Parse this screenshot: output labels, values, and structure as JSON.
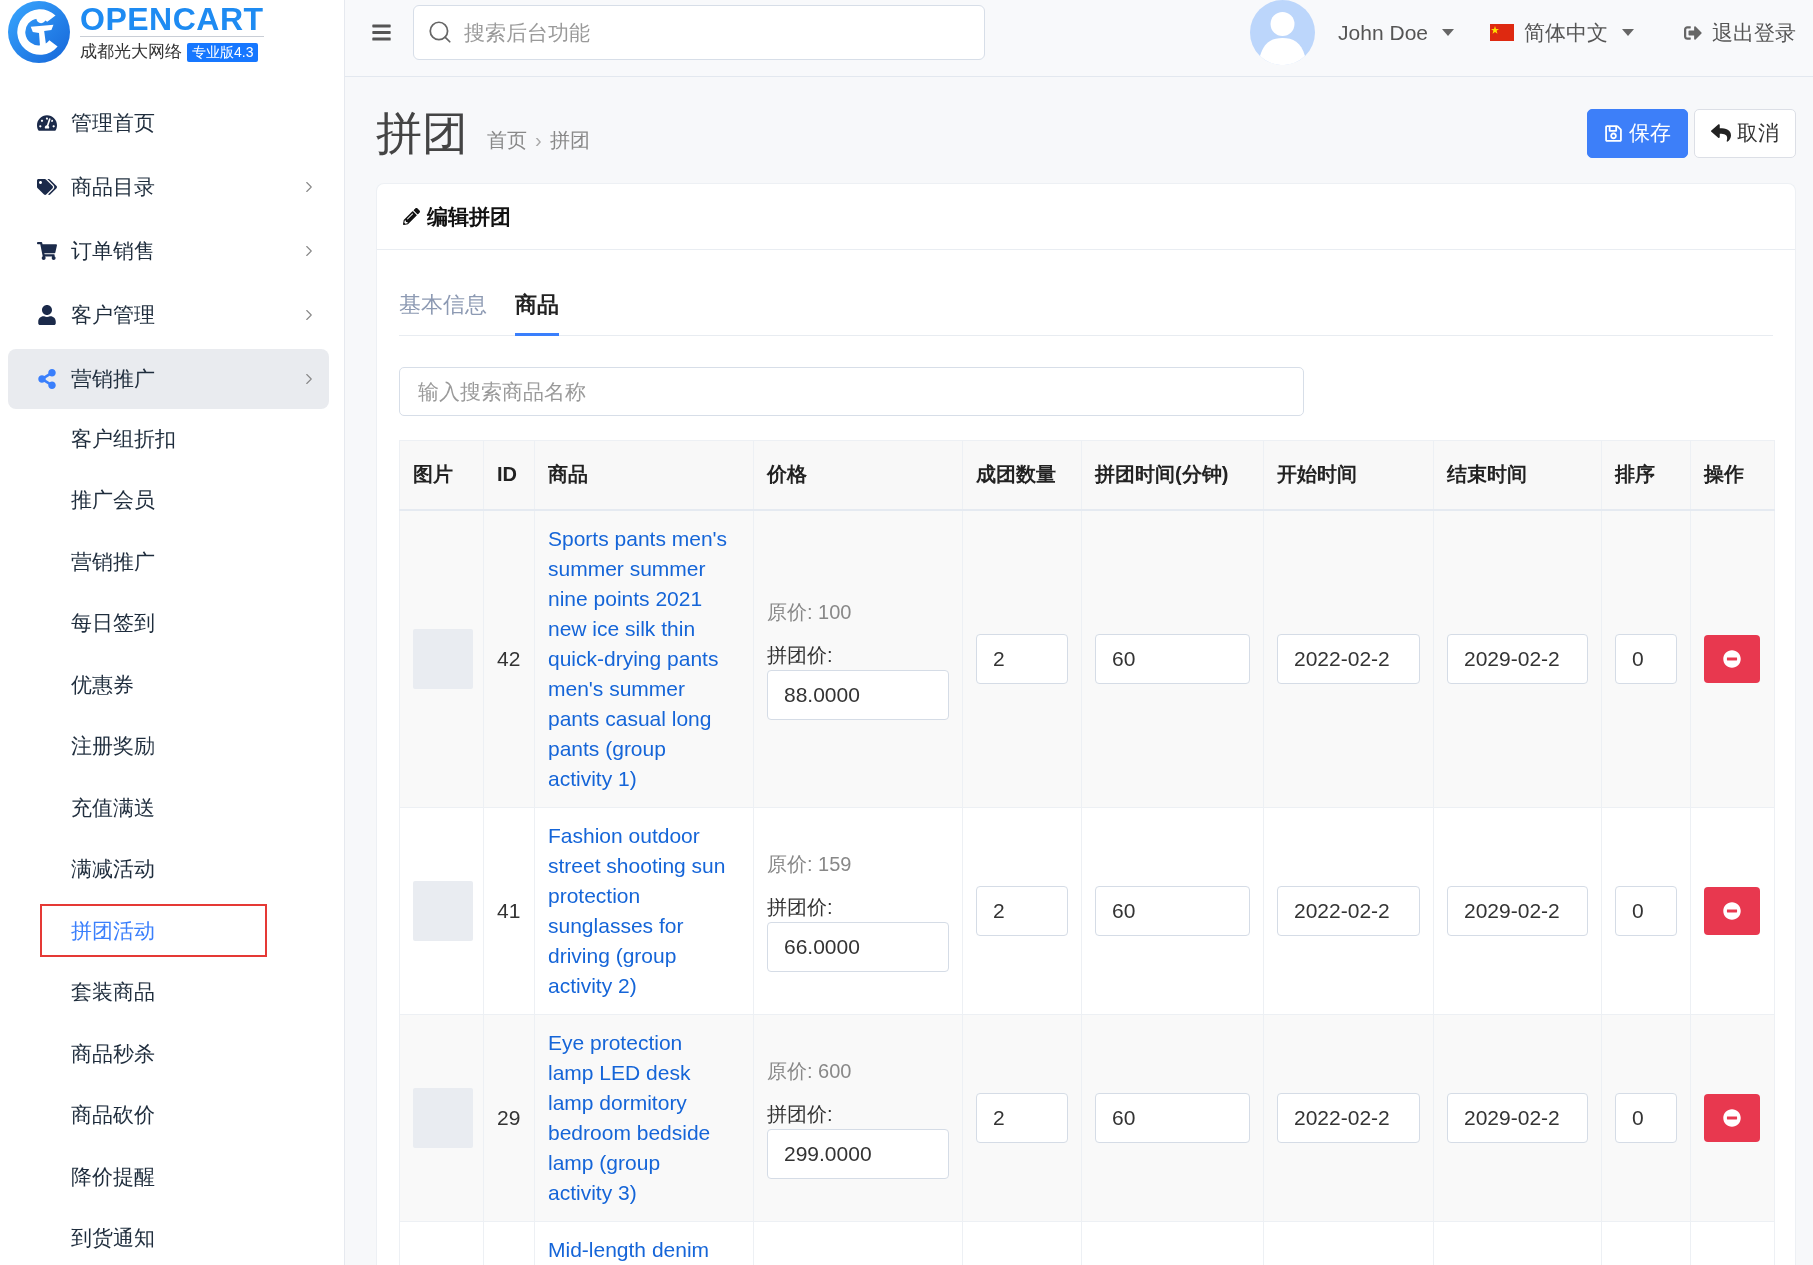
{
  "brand": {
    "name": "OPENCART",
    "company": "成都光大网络",
    "edition": "专业版4.3"
  },
  "header": {
    "search": {
      "placeholder": "搜索后台功能"
    },
    "user": "John Doe",
    "language": "简体中文",
    "logout": "退出登录"
  },
  "sidebar": {
    "items": [
      {
        "label": "管理首页",
        "has_submenu": false,
        "expanded": false
      },
      {
        "label": "商品目录",
        "has_submenu": true,
        "expanded": false
      },
      {
        "label": "订单销售",
        "has_submenu": true,
        "expanded": false
      },
      {
        "label": "客户管理",
        "has_submenu": true,
        "expanded": false
      },
      {
        "label": "营销推广",
        "has_submenu": true,
        "expanded": true,
        "children": [
          {
            "label": "客户组折扣",
            "selected": false
          },
          {
            "label": "推广会员",
            "selected": false
          },
          {
            "label": "营销推广",
            "selected": false
          },
          {
            "label": "每日签到",
            "selected": false
          },
          {
            "label": "优惠券",
            "selected": false
          },
          {
            "label": "注册奖励",
            "selected": false
          },
          {
            "label": "充值满送",
            "selected": false
          },
          {
            "label": "满减活动",
            "selected": false
          },
          {
            "label": "拼团活动",
            "selected": true
          },
          {
            "label": "套装商品",
            "selected": false
          },
          {
            "label": "商品秒杀",
            "selected": false
          },
          {
            "label": "商品砍价",
            "selected": false
          },
          {
            "label": "降价提醒",
            "selected": false
          },
          {
            "label": "到货通知",
            "selected": false
          }
        ]
      }
    ]
  },
  "page": {
    "title": "拼团",
    "breadcrumbs": [
      "首页",
      "拼团"
    ],
    "breadcrumb_separator": "›",
    "save": "保存",
    "cancel": "取消"
  },
  "card": {
    "title": "编辑拼团",
    "tabs": [
      {
        "label": "基本信息",
        "selected": false
      },
      {
        "label": "商品",
        "selected": true
      }
    ],
    "product_search": {
      "placeholder": "输入搜索商品名称"
    },
    "table": {
      "columns": [
        "图片",
        "ID",
        "商品",
        "价格",
        "成团数量",
        "拼团时间(分钟)",
        "开始时间",
        "结束时间",
        "排序",
        "操作"
      ],
      "rows": [
        {
          "id": "42",
          "name": "Sports pants men's summer summer nine points 2021 new ice silk thin quick-drying pants men's summer pants casual long pants (group activity 1)",
          "original_price": "原价: 100",
          "group_price_label": "拼团价:",
          "group_price": "88.0000",
          "group_size": "2",
          "duration": "60",
          "start_date": "2022-02-2",
          "end_date": "2029-02-2",
          "sort_order": "0"
        },
        {
          "id": "41",
          "name": "Fashion outdoor street shooting sun protection sunglasses for driving (group activity 2)",
          "original_price": "原价: 159",
          "group_price_label": "拼团价:",
          "group_price": "66.0000",
          "group_size": "2",
          "duration": "60",
          "start_date": "2022-02-2",
          "end_date": "2029-02-2",
          "sort_order": "0"
        },
        {
          "id": "29",
          "name": "Eye protection lamp LED desk lamp dormitory bedroom bedside lamp (group activity 3)",
          "original_price": "原价: 600",
          "group_price_label": "拼团价:",
          "group_price": "299.0000",
          "group_size": "2",
          "duration": "60",
          "start_date": "2022-02-2",
          "end_date": "2029-02-2",
          "sort_order": "0"
        },
        {
          "name": "Mid-length denim"
        }
      ]
    }
  }
}
